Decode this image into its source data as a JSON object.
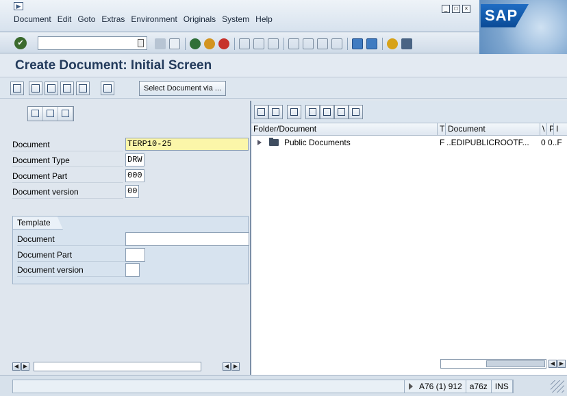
{
  "menu": {
    "items": [
      "Document",
      "Edit",
      "Goto",
      "Extras",
      "Environment",
      "Originals",
      "System",
      "Help"
    ],
    "logo_text": "SAP"
  },
  "toolbar": {
    "command_value": ""
  },
  "page": {
    "title": "Create Document: Initial Screen"
  },
  "app_toolbar": {
    "select_button_label": "Select Document via ..."
  },
  "form": {
    "document_label": "Document",
    "document_value": "TERP10-25",
    "doc_type_label": "Document Type",
    "doc_type_value": "DRW",
    "doc_part_label": "Document Part",
    "doc_part_value": "000",
    "doc_version_label": "Document version",
    "doc_version_value": "00"
  },
  "template": {
    "tab_label": "Template",
    "document_label": "Document",
    "doc_part_label": "Document Part",
    "doc_version_label": "Document version"
  },
  "tree": {
    "columns": [
      "Folder/Document",
      "T",
      "Document",
      "\\",
      "P",
      "I"
    ],
    "rows": [
      {
        "name": "Public Documents",
        "type": "F",
        "document": "..EDIPUBLICROOTF...",
        "extra": "0 0..F"
      }
    ]
  },
  "status": {
    "system": "A76 (1) 912",
    "server": "a76z",
    "mode": "INS"
  },
  "colors": {
    "title": "#233b5c",
    "required_field": "#fbf6a9",
    "background": "#dfe6ee"
  }
}
